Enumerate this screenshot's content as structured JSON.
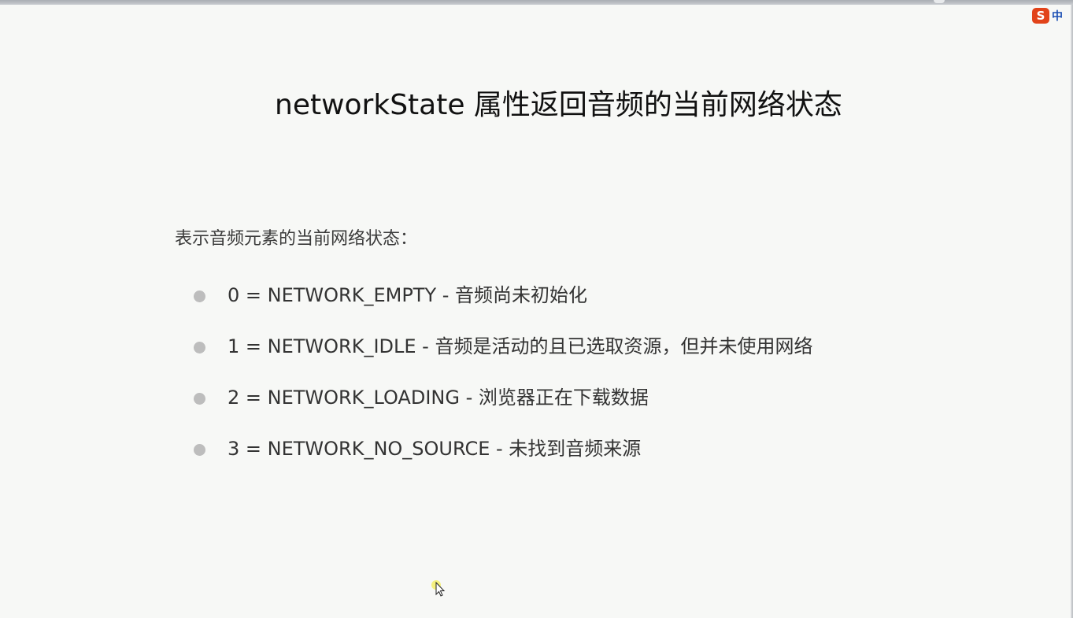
{
  "ime": {
    "logo_letter": "S",
    "mode": "中"
  },
  "slide": {
    "title": "networkState 属性返回音频的当前网络状态",
    "intro": "表示音频元素的当前网络状态：",
    "items": [
      "0 = NETWORK_EMPTY - 音频尚未初始化",
      "1 = NETWORK_IDLE - 音频是活动的且已选取资源，但并未使用网络",
      "2 = NETWORK_LOADING - 浏览器正在下载数据",
      "3 = NETWORK_NO_SOURCE - 未找到音频来源"
    ]
  },
  "colors": {
    "background": "#f7f8f6",
    "ime_logo": "#e2431a",
    "ime_mode": "#1b4fb4",
    "bullet": "#bdbdbd"
  },
  "icons": {
    "ime_logo": "sogou-ime-icon",
    "cursor": "mouse-pointer-icon"
  }
}
